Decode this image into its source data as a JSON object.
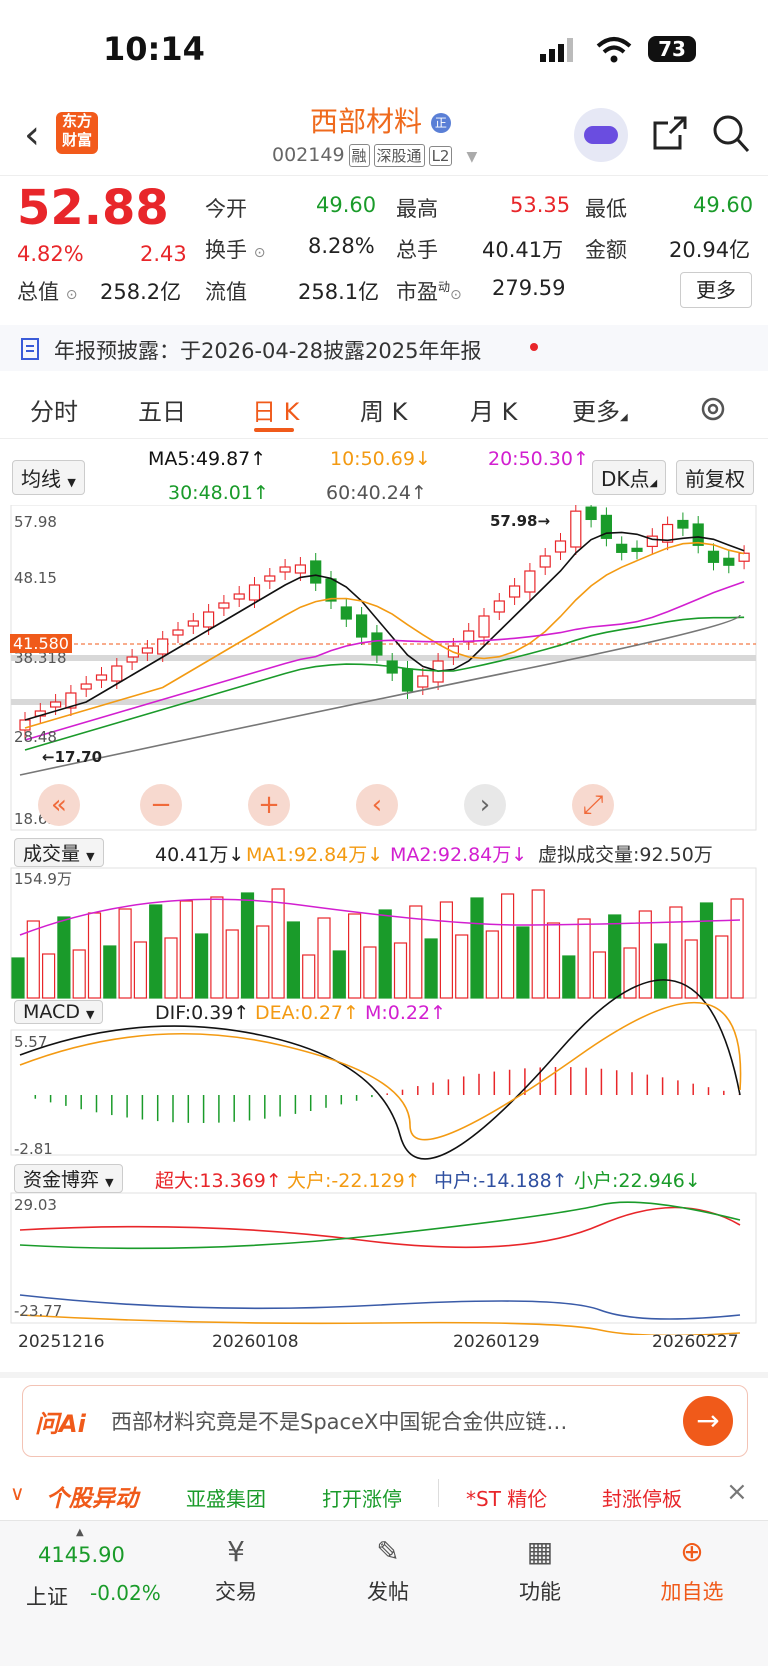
{
  "status": {
    "time": "10:14",
    "battery": "73"
  },
  "header": {
    "name": "西部材料",
    "name_badge": "正",
    "code": "002149",
    "tags": [
      "融",
      "深股通",
      "L2"
    ],
    "logo_line1": "东方",
    "logo_line2": "财富"
  },
  "quote": {
    "price": "52.88",
    "change_pct": "4.82%",
    "change": "2.43",
    "open_label": "今开",
    "open": "49.60",
    "high_label": "最高",
    "high": "53.35",
    "low_label": "最低",
    "low": "49.60",
    "turnover_label": "换手",
    "turnover": "8.28%",
    "volume_label": "总手",
    "volume": "40.41万",
    "amount_label": "金额",
    "amount": "20.94亿",
    "mktcap_label": "总值",
    "mktcap": "258.2亿",
    "float_label": "流值",
    "float": "258.1亿",
    "pe_label": "市盈",
    "pe_sup": "动",
    "pe": "279.59",
    "more": "更多"
  },
  "notice": {
    "text": "年报预披露：于2026-04-28披露2025年年报"
  },
  "tabs": [
    "分时",
    "五日",
    "日 K",
    "周 K",
    "月 K",
    "更多"
  ],
  "ma_bar": {
    "selector": "均线",
    "ma5": "MA5:49.87↑",
    "ma10": "10:50.69↓",
    "ma20": "20:50.30↑",
    "ma30": "30:48.01↑",
    "ma60": "60:40.24↑",
    "dk": "DK点",
    "fq": "前复权"
  },
  "kline": {
    "y_labels": [
      "57.98",
      "48.15",
      "38.318",
      "28.48",
      "18.65"
    ],
    "current_price_tag": "41.580",
    "max_marker": "57.98",
    "min_marker": "17.70",
    "dates": [
      "20251216",
      "20260108",
      "20260129",
      "20260227"
    ],
    "colors": {
      "up": "#e8262a",
      "down": "#1a9b2a",
      "ma5": "#111111",
      "ma10": "#f39a12",
      "ma20": "#d21fd0",
      "ma30": "#1a9b2a",
      "ma60": "#777777"
    }
  },
  "volume_bar": {
    "selector": "成交量",
    "vol": "40.41万↓",
    "ma1": "MA1:92.84万↓",
    "ma2": "MA2:92.84万↓",
    "virtual": "虚拟成交量:92.50万",
    "top_label": "154.9万"
  },
  "macd_bar": {
    "selector": "MACD",
    "dif": "DIF:0.39↑",
    "dea": "DEA:0.27↑",
    "m": "M:0.22↑",
    "top": "5.57",
    "bottom": "-2.81"
  },
  "fund_bar": {
    "selector": "资金博弈",
    "super": "超大:13.369↑",
    "large": "大户:-22.129↑",
    "mid": "中户:-14.188↑",
    "small": "小户:22.946↓",
    "top": "29.03",
    "bottom": "-23.77"
  },
  "ai": {
    "brand": "问Ai",
    "text": "西部材料究竟是不是SpaceX中国铌合金供应链…"
  },
  "ticker": {
    "title": "个股异动",
    "items": [
      "亚盛集团",
      "打开涨停",
      "*ST 精伦",
      "封涨停板"
    ]
  },
  "bottom_nav": {
    "index_value": "4145.90",
    "index_name": "上证",
    "index_change": "-0.02%",
    "items": [
      "交易",
      "发帖",
      "功能",
      "加自选"
    ]
  }
}
